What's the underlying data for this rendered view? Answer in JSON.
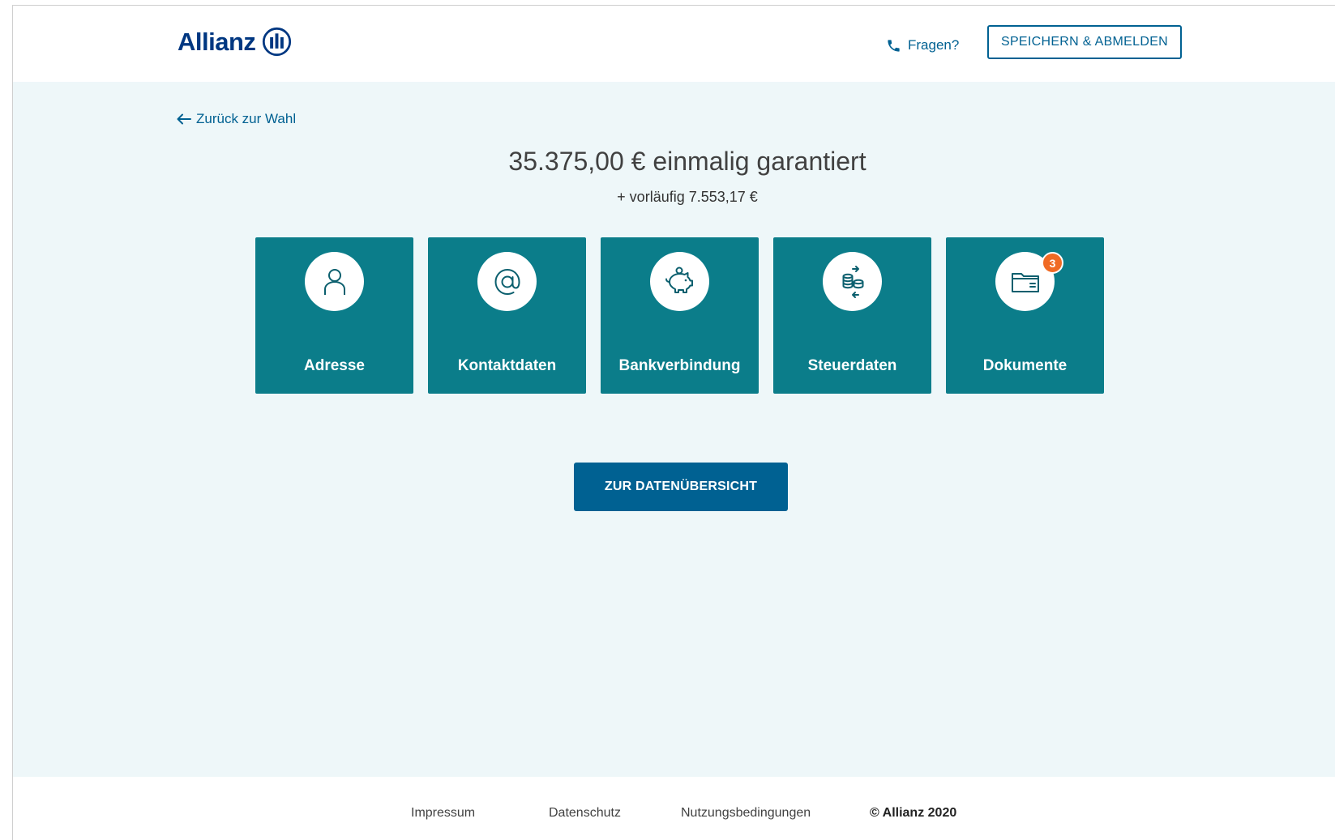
{
  "header": {
    "logo_text": "Allianz",
    "help_label": "Fragen?",
    "save_logout_label": "SPEICHERN & ABMELDEN"
  },
  "main": {
    "back_label": "Zurück zur Wahl",
    "amount": "35.375,00 € einmalig garantiert",
    "amount_sub": "+ vorläufig 7.553,17 €",
    "tiles": [
      {
        "label": "Adresse",
        "icon": "person-icon"
      },
      {
        "label": "Kontaktdaten",
        "icon": "at-sign-icon"
      },
      {
        "label": "Bankverbindung",
        "icon": "piggy-bank-icon"
      },
      {
        "label": "Steuerdaten",
        "icon": "coins-exchange-icon"
      },
      {
        "label": "Dokumente",
        "icon": "folder-icon",
        "badge": "3"
      }
    ],
    "overview_button_label": "ZUR DATENÜBERSICHT"
  },
  "footer": {
    "impressum": "Impressum",
    "datenschutz": "Datenschutz",
    "nutzungsbedingungen": "Nutzungsbedingungen",
    "copyright": "© Allianz 2020"
  },
  "colors": {
    "brand_blue": "#003781",
    "link_blue": "#006192",
    "tile_teal": "#0b7d8a",
    "page_bg": "#eef7f9",
    "badge_orange": "#f06a24"
  }
}
